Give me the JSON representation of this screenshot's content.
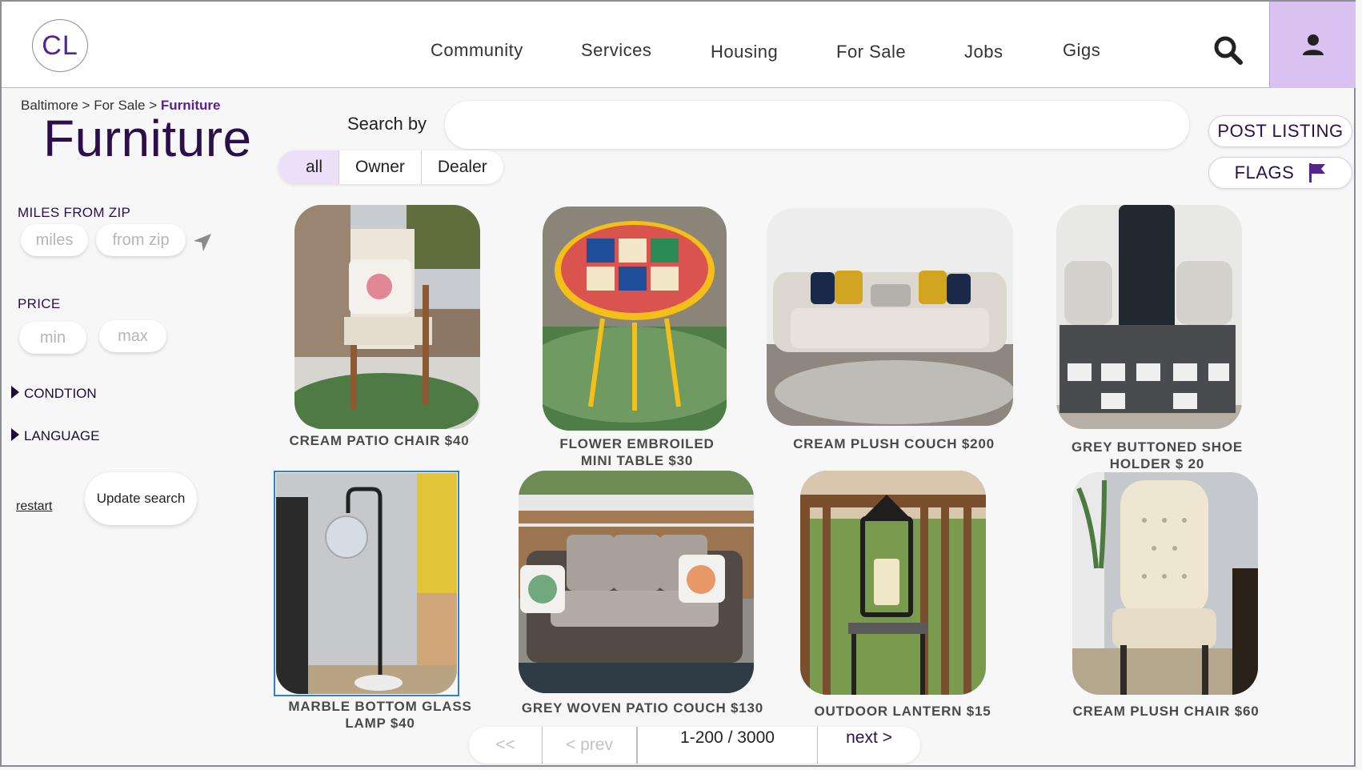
{
  "header": {
    "logo": "CL",
    "nav": [
      "Community",
      "Services",
      "Housing",
      "For Sale",
      "Jobs",
      "Gigs"
    ]
  },
  "breadcrumb": {
    "city": "Baltimore",
    "section": "For Sale",
    "current": "Furniture",
    "sep": ">"
  },
  "page_title": "Furniture",
  "search": {
    "label": "Search by",
    "value": "",
    "placeholder": ""
  },
  "filter_tabs": {
    "items": [
      "all",
      "Owner",
      "Dealer"
    ],
    "selected": "all"
  },
  "actions": {
    "post_listing": "POST LISTING",
    "flags": "FLAGS"
  },
  "sidebar": {
    "miles_label": "MILES FROM ZIP",
    "miles_placeholder": "miles",
    "zip_placeholder": "from zip",
    "price_label": "PRICE",
    "min_placeholder": "min",
    "max_placeholder": "max",
    "condition": "CONDTION",
    "language": "LANGUAGE",
    "restart": "restart",
    "update": "Update search"
  },
  "listings": [
    {
      "title": "CREAM PATIO CHAIR $40",
      "icon": "patio-chair-photo"
    },
    {
      "title": "FLOWER EMBROILED MINI TABLE $30",
      "icon": "mosaic-table-photo"
    },
    {
      "title": "CREAM PLUSH COUCH $200",
      "icon": "couch-photo"
    },
    {
      "title": "GREY BUTTONED SHOE HOLDER $ 20",
      "icon": "shoe-bench-photo"
    },
    {
      "title": "MARBLE BOTTOM GLASS LAMP $40",
      "icon": "floor-lamp-photo",
      "selected": true
    },
    {
      "title": "GREY WOVEN PATIO COUCH $130",
      "icon": "patio-couch-photo"
    },
    {
      "title": "OUTDOOR LANTERN $15",
      "icon": "lantern-photo"
    },
    {
      "title": "CREAM PLUSH CHAIR $60",
      "icon": "tufted-chair-photo"
    }
  ],
  "pagination": {
    "first": "<<",
    "prev": "< prev",
    "range": "1-200 / 3000",
    "next": "next >"
  },
  "colors": {
    "accent": "#54248f",
    "accent_light": "#d9c2f2",
    "title": "#2a0f4a",
    "selection": "#2f7fd0"
  }
}
